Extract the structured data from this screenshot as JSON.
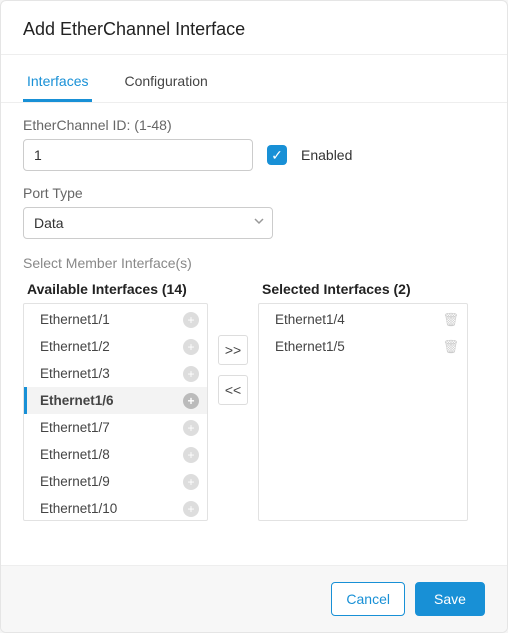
{
  "dialog": {
    "title": "Add EtherChannel Interface"
  },
  "tabs": {
    "interfaces": "Interfaces",
    "configuration": "Configuration"
  },
  "fields": {
    "etherchannel_id_label": "EtherChannel ID: (1-48)",
    "etherchannel_id_value": "1",
    "enabled_label": "Enabled",
    "enabled_checked": true,
    "port_type_label": "Port Type",
    "port_type_value": "Data",
    "select_members_label": "Select Member Interface(s)"
  },
  "available": {
    "title": "Available Interfaces (14)",
    "items": [
      {
        "label": "Ethernet1/1",
        "highlight": false
      },
      {
        "label": "Ethernet1/2",
        "highlight": false
      },
      {
        "label": "Ethernet1/3",
        "highlight": false
      },
      {
        "label": "Ethernet1/6",
        "highlight": true
      },
      {
        "label": "Ethernet1/7",
        "highlight": false
      },
      {
        "label": "Ethernet1/8",
        "highlight": false
      },
      {
        "label": "Ethernet1/9",
        "highlight": false
      },
      {
        "label": "Ethernet1/10",
        "highlight": false
      }
    ]
  },
  "selected": {
    "title": "Selected Interfaces (2)",
    "items": [
      {
        "label": "Ethernet1/4"
      },
      {
        "label": "Ethernet1/5"
      }
    ]
  },
  "move": {
    "add_all": ">>",
    "remove_all": "<<"
  },
  "footer": {
    "cancel": "Cancel",
    "save": "Save"
  },
  "icons": {
    "check": "✓",
    "plus": "+",
    "trash": "🗑"
  }
}
